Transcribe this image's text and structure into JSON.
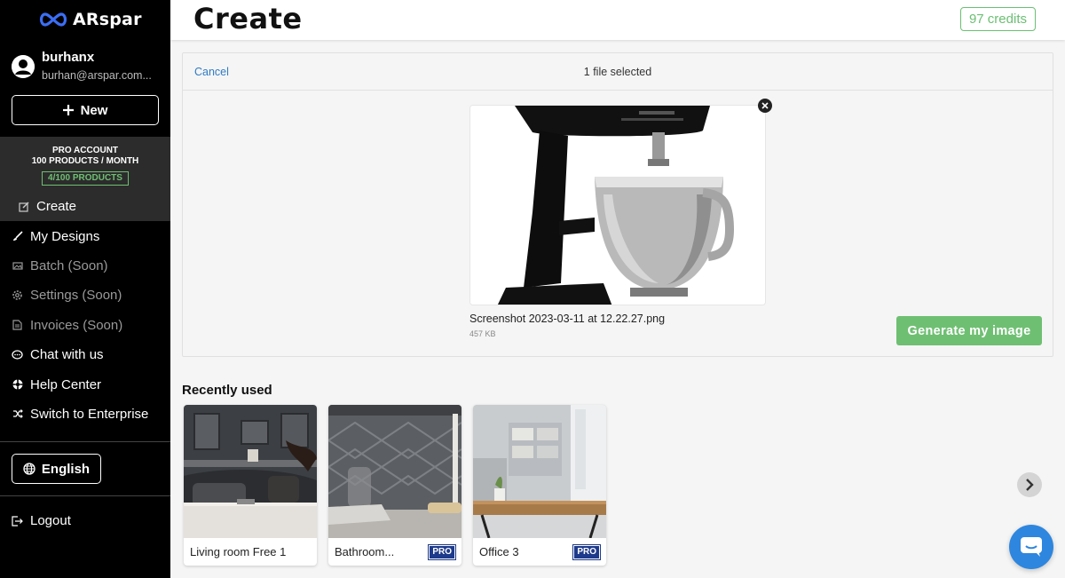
{
  "brand": {
    "name": "ARspar"
  },
  "user": {
    "name": "burhanx",
    "email": "burhan@arspar.com..."
  },
  "sidebar": {
    "new_label": "New",
    "plan": {
      "line1": "PRO ACCOUNT",
      "line2": "100 PRODUCTS / MONTH",
      "usage": "4/100 PRODUCTS"
    },
    "items": [
      {
        "label": "Create",
        "icon": "edit-icon",
        "active": true
      },
      {
        "label": "My Designs",
        "icon": "brush-icon"
      },
      {
        "label": "Batch (Soon)",
        "icon": "images-icon",
        "soon": true
      },
      {
        "label": "Settings (Soon)",
        "icon": "gear-icon",
        "soon": true
      },
      {
        "label": "Invoices (Soon)",
        "icon": "document-icon",
        "soon": true
      },
      {
        "label": "Chat with us",
        "icon": "chat-bubble-icon"
      },
      {
        "label": "Help Center",
        "icon": "lifebuoy-icon"
      },
      {
        "label": "Switch to Enterprise",
        "icon": "shuffle-icon"
      }
    ],
    "language_label": "English",
    "logout_label": "Logout"
  },
  "header": {
    "title": "Create",
    "credits": "97 credits"
  },
  "upload": {
    "cancel_label": "Cancel",
    "status": "1 file selected",
    "file_name": "Screenshot 2023-03-11 at 12.22.27.png",
    "file_size": "457 KB",
    "generate_label": "Generate my image"
  },
  "recent": {
    "title": "Recently used",
    "items": [
      {
        "label": "Living room Free 1",
        "pro": false
      },
      {
        "label": "Bathroom...",
        "pro": true,
        "badge": "PRO"
      },
      {
        "label": "Office 3",
        "pro": true,
        "badge": "PRO"
      }
    ]
  },
  "colors": {
    "accent_green": "#6fbf73",
    "link_blue": "#2f7bc4",
    "pro_blue": "#1e3a8a",
    "chat_blue": "#2e86de"
  }
}
